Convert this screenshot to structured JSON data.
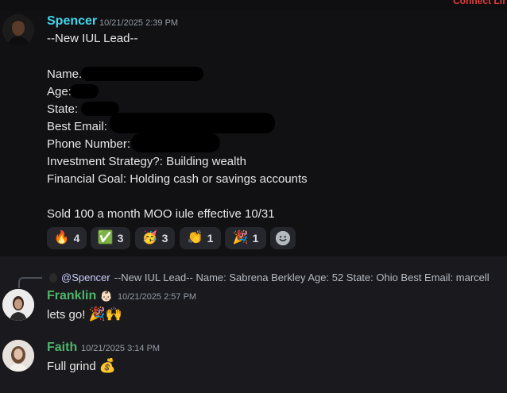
{
  "top_partial_text": "Connect Lif",
  "message1": {
    "author": "Spencer",
    "author_color": "#3fd6ee",
    "timestamp": "10/21/2025 2:39 PM",
    "lines": [
      "--New IUL Lead--",
      "Name.",
      "Age:",
      "State:",
      "Best Email:",
      "Phone Number:",
      "Investment Strategy?: Building wealth",
      "Financial Goal: Holding cash or savings accounts",
      "Sold 100 a month MOO iule effective 10/31"
    ],
    "reactions": [
      {
        "icon": "fire",
        "emoji": "🔥",
        "count": "4"
      },
      {
        "icon": "check-mark-button",
        "emoji": "✅",
        "count": "3"
      },
      {
        "icon": "partying-face",
        "emoji": "🥳",
        "count": "3"
      },
      {
        "icon": "clapping-hands",
        "emoji": "👏",
        "count": "1"
      },
      {
        "icon": "party-popper",
        "emoji": "🎉",
        "count": "1"
      }
    ],
    "add_reaction_icon": "smiley-add-reaction"
  },
  "reply": {
    "mention": "@Spencer",
    "preview": "--New IUL Lead--  Name: Sabrena  Berkley   Age: 52 State: Ohio Best Email: marcell"
  },
  "message2": {
    "author": "Franklin",
    "author_color": "#4fb56a",
    "badge": "👶🏻",
    "timestamp": "10/21/2025 2:57 PM",
    "text": "lets go!",
    "emojis": "🎉🙌"
  },
  "message3": {
    "author": "Faith",
    "author_color": "#4fb56a",
    "timestamp": "10/21/2025 3:14 PM",
    "text": "Full grind",
    "emojis": "💰"
  }
}
